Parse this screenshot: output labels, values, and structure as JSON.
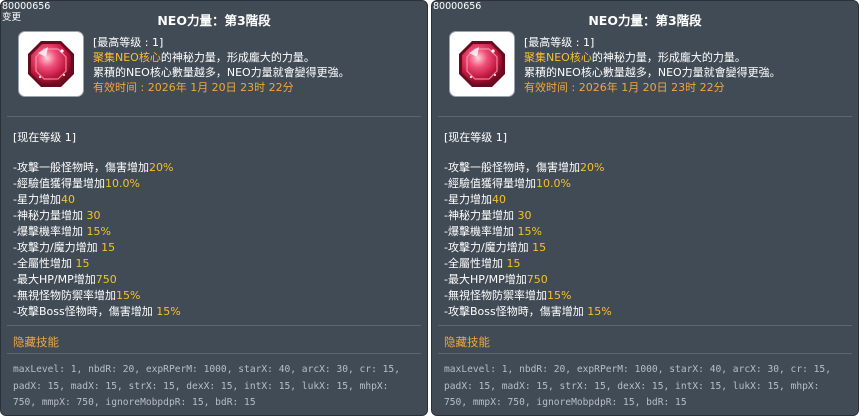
{
  "tooltips": [
    {
      "id_text": "80000656",
      "sub_text": "变更",
      "title": "NEO力量：第3階段",
      "icon": "red-gem-icon",
      "desc": {
        "max_level": "[最高等级 : 1]",
        "line2_highlight": "聚集NEO核心",
        "line2_rest": "的神秘力量，形成龐大的力量。",
        "line3": "累積的NEO核心數量越多，NEO力量就會變得更強。",
        "expiry": "有效时间 : 2026年 1月 20日 23时 22分"
      },
      "current_level": "[现在等级 1]",
      "stats": [
        {
          "label": "-攻擊一般怪物時，傷害增加",
          "value": "20%"
        },
        {
          "label": " -經驗值獲得量增加",
          "value": "10.0%"
        },
        {
          "label": " -星力增加",
          "value": "40"
        },
        {
          "label": " -神秘力量增加 ",
          "value": "30"
        },
        {
          "label": " -爆擊機率增加 ",
          "value": "15%"
        },
        {
          "label": " -攻擊力/魔力增加 ",
          "value": "15"
        },
        {
          "label": " -全屬性增加 ",
          "value": "15"
        },
        {
          "label": " -最大HP/MP增加",
          "value": "750"
        },
        {
          "label": " -無視怪物防禦率增加",
          "value": "15%"
        },
        {
          "label": " -攻擊Boss怪物時，傷害增加 ",
          "value": "15%"
        }
      ],
      "hidden_skill_title": "隐藏技能",
      "debug_text": "maxLevel: 1, nbdR: 20, expRPerM: 1000, starX: 40, arcX: 30, cr: 15, padX: 15, madX: 15, strX: 15, dexX: 15, intX: 15, lukX: 15, mhpX: 750, mmpX: 750, ignoreMobpdpR: 15, bdR: 15"
    },
    {
      "id_text": "80000656",
      "sub_text": "",
      "title": "NEO力量：第3階段",
      "icon": "red-gem-icon",
      "desc": {
        "max_level": "[最高等级 : 1]",
        "line2_highlight": "聚集NEO核心",
        "line2_rest": "的神秘力量，形成龐大的力量。",
        "line3": "累積的NEO核心數量越多，NEO力量就會變得更強。",
        "expiry": "有效时间 : 2026年 1月 20日 23时 22分"
      },
      "current_level": "[现在等级 1]",
      "stats": [
        {
          "label": "-攻擊一般怪物時，傷害增加",
          "value": "20%"
        },
        {
          "label": " -經驗值獲得量增加",
          "value": "10.0%"
        },
        {
          "label": " -星力增加",
          "value": "40"
        },
        {
          "label": " -神秘力量增加 ",
          "value": "30"
        },
        {
          "label": " -爆擊機率增加 ",
          "value": "15%"
        },
        {
          "label": " -攻擊力/魔力增加 ",
          "value": "15"
        },
        {
          "label": " -全屬性增加 ",
          "value": "15"
        },
        {
          "label": " -最大HP/MP增加",
          "value": "750"
        },
        {
          "label": " -無視怪物防禦率增加",
          "value": "15%"
        },
        {
          "label": " -攻擊Boss怪物時，傷害增加 ",
          "value": "15%"
        }
      ],
      "hidden_skill_title": "隐藏技能",
      "debug_text": "maxLevel: 1, nbdR: 20, expRPerM: 1000, starX: 40, arcX: 30, cr: 15, padX: 15, madX: 15, strX: 15, dexX: 15, intX: 15, lukX: 15, mhpX: 750, mmpX: 750, ignoreMobpdpR: 15, bdR: 15"
    }
  ]
}
